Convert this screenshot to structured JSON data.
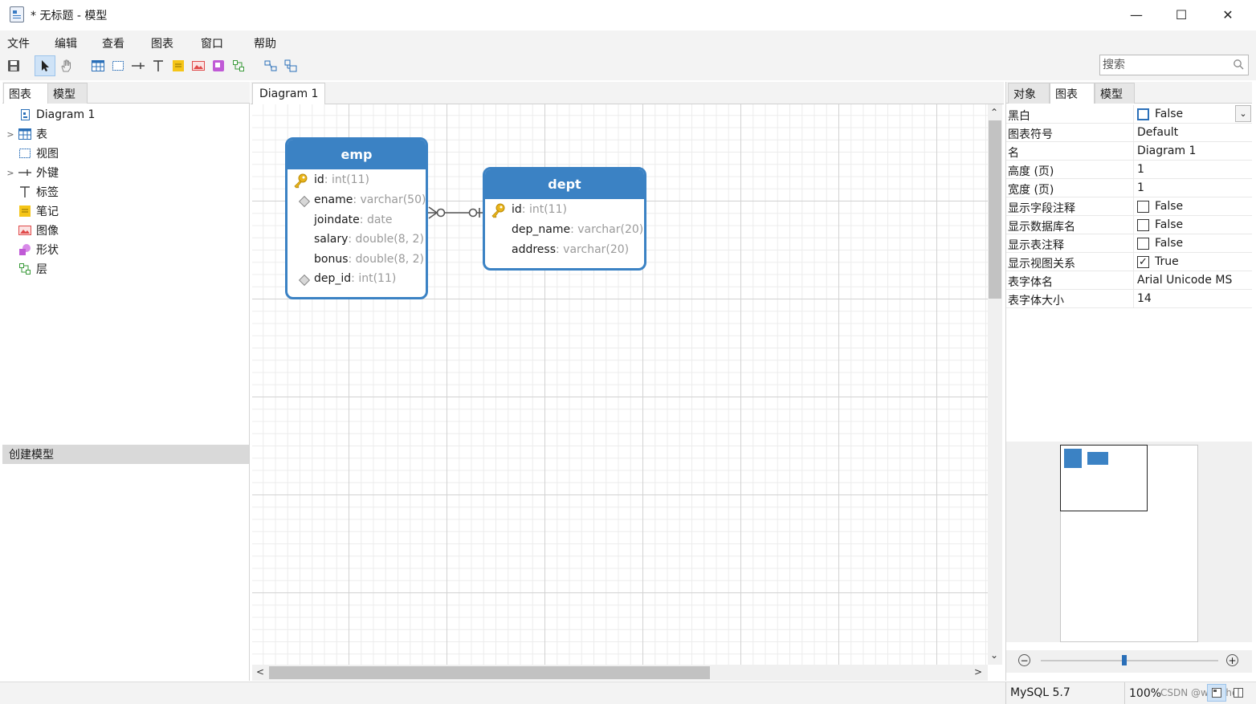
{
  "window": {
    "title": "* 无标题 - 模型",
    "minimize": "—",
    "maximize": "☐",
    "close": "✕"
  },
  "menu": [
    "文件",
    "编辑",
    "查看",
    "图表",
    "窗口",
    "帮助"
  ],
  "search": {
    "placeholder": "搜索"
  },
  "left_panel": {
    "tabs": [
      "图表",
      "模型"
    ],
    "active_tab": "图表",
    "tree": [
      {
        "label": "Diagram 1",
        "icon": "diagram-icon",
        "expandable": false
      },
      {
        "label": "表",
        "icon": "table-icon",
        "expandable": true
      },
      {
        "label": "视图",
        "icon": "view-icon",
        "expandable": false
      },
      {
        "label": "外键",
        "icon": "foreign-key-icon",
        "expandable": true
      },
      {
        "label": "标签",
        "icon": "label-icon",
        "expandable": false
      },
      {
        "label": "笔记",
        "icon": "note-icon",
        "expandable": false
      },
      {
        "label": "图像",
        "icon": "image-icon",
        "expandable": false
      },
      {
        "label": "形状",
        "icon": "shape-icon",
        "expandable": false
      },
      {
        "label": "层",
        "icon": "layer-icon",
        "expandable": false
      }
    ],
    "create_model_header": "创建模型"
  },
  "diagram": {
    "tab": "Diagram 1",
    "entities": [
      {
        "name": "emp",
        "fields": [
          {
            "name": "id",
            "type": ": int(11)",
            "marker": "primary-key"
          },
          {
            "name": "ename",
            "type": ": varchar(50)",
            "marker": "index"
          },
          {
            "name": "joindate",
            "type": ": date",
            "marker": "none"
          },
          {
            "name": "salary",
            "type": ": double(8, 2)",
            "marker": "none"
          },
          {
            "name": "bonus",
            "type": ": double(8, 2)",
            "marker": "none"
          },
          {
            "name": "dep_id",
            "type": ": int(11)",
            "marker": "index"
          }
        ]
      },
      {
        "name": "dept",
        "fields": [
          {
            "name": "id",
            "type": ": int(11)",
            "marker": "primary-key"
          },
          {
            "name": "dep_name",
            "type": ": varchar(20)",
            "marker": "none"
          },
          {
            "name": "address",
            "type": ": varchar(20)",
            "marker": "none"
          }
        ]
      }
    ]
  },
  "right_panel": {
    "tabs": [
      "对象",
      "图表",
      "模型"
    ],
    "active_tab": "图表",
    "properties": [
      {
        "label": "黑白",
        "value": "False",
        "checkbox": "unchecked"
      },
      {
        "label": "图表符号",
        "value": "Default",
        "checkbox": "none"
      },
      {
        "label": "名",
        "value": "Diagram 1",
        "checkbox": "none"
      },
      {
        "label": "高度 (页)",
        "value": "1",
        "checkbox": "none"
      },
      {
        "label": "宽度 (页)",
        "value": "1",
        "checkbox": "none"
      },
      {
        "label": "显示字段注释",
        "value": "False",
        "checkbox": "unchecked"
      },
      {
        "label": "显示数据库名",
        "value": "False",
        "checkbox": "unchecked"
      },
      {
        "label": "显示表注释",
        "value": "False",
        "checkbox": "unchecked"
      },
      {
        "label": "显示视图关系",
        "value": "True",
        "checkbox": "checked"
      },
      {
        "label": "表字体名",
        "value": "Arial Unicode MS",
        "checkbox": "none"
      },
      {
        "label": "表字体大小",
        "value": "14",
        "checkbox": "none"
      }
    ],
    "zoom": {
      "minus": "−",
      "plus": "+",
      "level_fraction": 0.47
    }
  },
  "status": {
    "db_version": "MySQL 5.7",
    "zoom": "100%",
    "watermark": "CSDN @wanchell"
  },
  "colors": {
    "entity": "#3b82c4",
    "key": "#e9b41a",
    "accent": "#2a6fb8"
  }
}
